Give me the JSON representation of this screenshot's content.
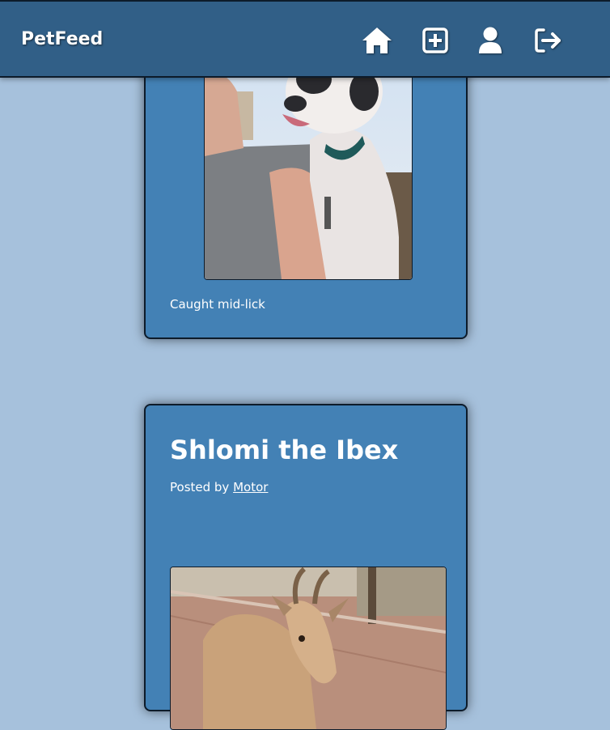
{
  "app": {
    "brand": "PetFeed"
  },
  "nav": {
    "icons": [
      "home-icon",
      "add-post-icon",
      "profile-icon",
      "logout-icon"
    ]
  },
  "posts": [
    {
      "caption": "Caught mid-lick"
    },
    {
      "title": "Shlomi the Ibex",
      "posted_by_prefix": "Posted by",
      "author": "Motor"
    }
  ],
  "colors": {
    "navbar": "#315f87",
    "page_bg": "#a6c1dc",
    "card_bg": "#4381b5",
    "border": "#0d1b2a"
  }
}
